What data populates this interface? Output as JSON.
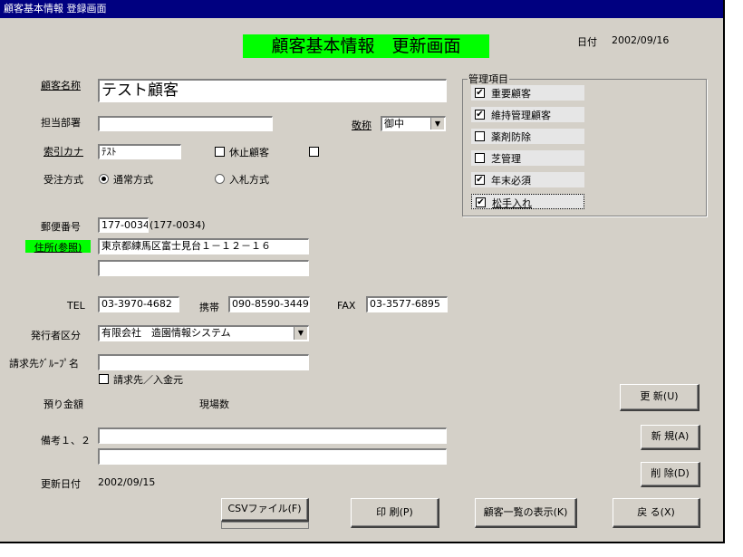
{
  "window": {
    "title": "顧客基本情報 登録画面"
  },
  "header": {
    "title": "顧客基本情報　更新画面",
    "date_label": "日付",
    "date_value": "2002/09/16"
  },
  "labels": {
    "customer_name": "顧客名称",
    "department": "担当部署",
    "honorific": "敬称",
    "index_kana": "索引カナ",
    "order_method": "受注方式",
    "postal": "郵便番号",
    "address": "住所(参照)",
    "tel": "TEL",
    "mobile": "携帯",
    "fax": "FAX",
    "issuer_category": "発行者区分",
    "billing_group": "請求先ｸﾞﾙｰﾌﾟ名",
    "deposit": "預り金額",
    "site_count": "現場数",
    "remarks": "備考１、２",
    "updated_date": "更新日付"
  },
  "fields": {
    "customer_name": "テスト顧客",
    "department": "",
    "honorific": "御中",
    "index_kana": "ﾃｽﾄ",
    "postal": "177-0034",
    "postal_echo": "(177-0034)",
    "address1": "東京都練馬区富士見台１－１２－１６",
    "address2": "",
    "tel": "03-3970-4682",
    "mobile": "090-8590-3449",
    "fax": "03-3577-6895",
    "issuer_category": "有限会社　造園情報システム",
    "billing_group": "",
    "remarks1": "",
    "remarks2": "",
    "updated_date": "2002/09/15"
  },
  "checks": {
    "suspended_label": "休止顧客",
    "suspended": false,
    "extra": false,
    "billing_deposit_label": "請求先／入金元",
    "billing_deposit": false
  },
  "order_methods": [
    {
      "label": "通常方式",
      "selected": true
    },
    {
      "label": "入札方式",
      "selected": false
    }
  ],
  "management": {
    "title": "管理項目",
    "items": [
      {
        "label": "重要顧客",
        "checked": true
      },
      {
        "label": "維持管理顧客",
        "checked": true
      },
      {
        "label": "薬剤防除",
        "checked": false
      },
      {
        "label": "芝管理",
        "checked": false
      },
      {
        "label": "年末必須",
        "checked": true
      },
      {
        "label": "松手入れ",
        "checked": true
      }
    ]
  },
  "buttons": {
    "update": "更 新(U)",
    "new": "新 規(A)",
    "delete": "削 除(D)",
    "csv": "CSVファイル(F)",
    "print": "印 刷(P)",
    "customer_list": "顧客一覧の表示(K)",
    "back": "戻 る(X)"
  },
  "colors": {
    "title_bar": "#000080",
    "highlight": "#00ff00",
    "face": "#d4d0c8"
  }
}
